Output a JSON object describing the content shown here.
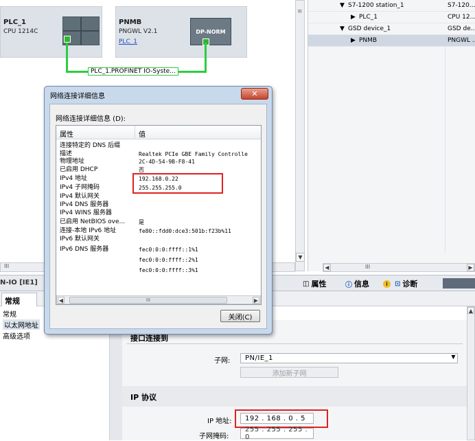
{
  "devices": {
    "plc": {
      "name": "PLC_1",
      "type": "CPU 1214C"
    },
    "pnmb": {
      "name": "PNMB",
      "type": "PNGWL V2.1",
      "link": "PLC_1",
      "module_label": "DP-NORM"
    }
  },
  "network_label": "PLC_1.PROFINET IO-Syste...",
  "tree": [
    {
      "arrow": "▼",
      "name": "S7-1200 station_1",
      "type": "S7-120..."
    },
    {
      "arrow": "▶",
      "name": "PLC_1",
      "type": "CPU 12..."
    },
    {
      "arrow": "▼",
      "name": "GSD device_1",
      "type": "GSD de..."
    },
    {
      "arrow": "▶",
      "name": "PNMB",
      "type": "PNGWL ..."
    }
  ],
  "dialog": {
    "title": "网络连接详细信息",
    "list_label": "网络连接详细信息 (D):",
    "col_property": "属性",
    "col_value": "值",
    "rows": [
      {
        "k": "连接特定的 DNS 后缀",
        "v": ""
      },
      {
        "k": "描述",
        "v": "Realtek PCIe GBE Family Controlle"
      },
      {
        "k": "物理地址",
        "v": "2C-4D-54-9B-F8-41"
      },
      {
        "k": "已启用 DHCP",
        "v": "否"
      },
      {
        "k": "IPv4 地址",
        "v": "192.168.0.22"
      },
      {
        "k": "IPv4 子网掩码",
        "v": "255.255.255.0"
      },
      {
        "k": "IPv4 默认网关",
        "v": ""
      },
      {
        "k": "IPv4 DNS 服务器",
        "v": ""
      },
      {
        "k": "IPv4 WINS 服务器",
        "v": ""
      },
      {
        "k": "已启用 NetBIOS ove...",
        "v": "是"
      },
      {
        "k": "连接-本地 IPv6 地址",
        "v": "fe80::fdd0:dce3:501b:f23b%11"
      },
      {
        "k": "IPv6 默认网关",
        "v": ""
      },
      {
        "k": "IPv6 DNS 服务器",
        "v": "fec0:0:0:ffff::1%1"
      },
      {
        "k": "",
        "v": "fec0:0:0:ffff::2%1"
      },
      {
        "k": "",
        "v": "fec0:0:0:ffff::3%1"
      }
    ],
    "close_button": "关闭(C)",
    "hscroll_mid": "III"
  },
  "inspector": {
    "left_title": "N-IO [IE1]",
    "tab_properties": "属性",
    "tab_info": "信息",
    "tab_diag": "诊断",
    "general_tab": "常规",
    "nav": [
      "常规",
      "以太网地址",
      "高级选项"
    ],
    "section_interface": "接口连接到",
    "subnet_label": "子网:",
    "subnet_value": "PN/IE_1",
    "add_subnet": "添加新子网",
    "section_ip": "IP 协议",
    "ip_label": "IP 地址:",
    "ip_value": "192 . 168 . 0   . 5",
    "mask_label": "子网掩码:",
    "mask_value": "255 . 255 . 255 . 0"
  },
  "scroll_mid": "III"
}
